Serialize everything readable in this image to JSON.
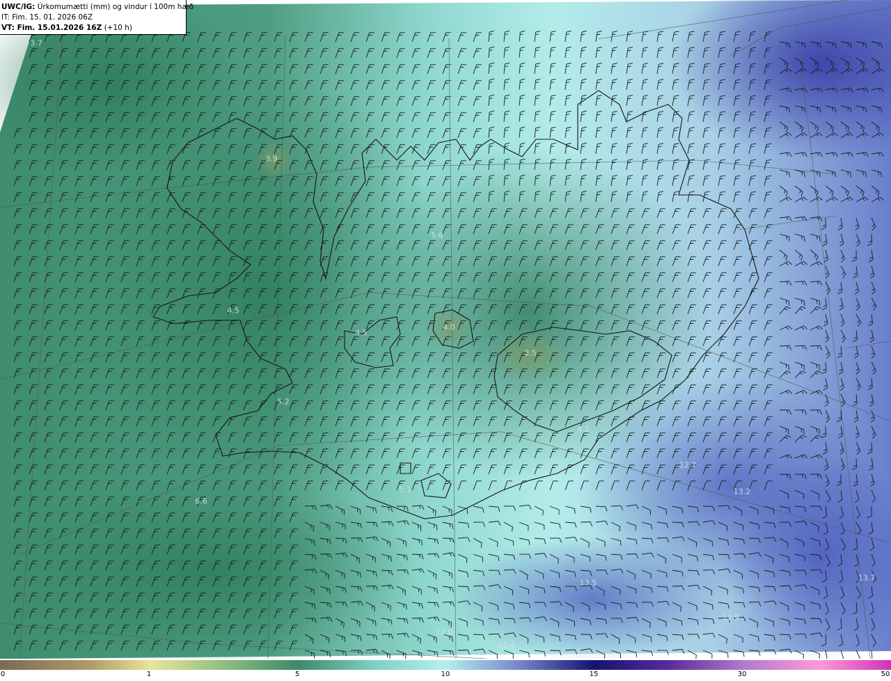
{
  "header": {
    "title_prefix": "UWC/IG:",
    "title_text": " Úrkomumætti (mm) og vindur í 100m hæð",
    "init_time": "IT: Fim. 15. 01. 2026 06Z",
    "valid_prefix": "VT: Fim. 15.01.2026 16Z",
    "valid_suffix": " (+10 h)"
  },
  "map": {
    "field_values": [
      {
        "text": "3.7"
      },
      {
        "text": "3.9"
      },
      {
        "text": "5.6"
      },
      {
        "text": "4.5"
      },
      {
        "text": "4.5"
      },
      {
        "text": "4.0"
      },
      {
        "text": "3.5"
      },
      {
        "text": "5.2"
      },
      {
        "text": "4.2"
      },
      {
        "text": "5.1"
      },
      {
        "text": "6.6"
      },
      {
        "text": "12.7"
      },
      {
        "text": "13.2"
      },
      {
        "text": "13.5"
      },
      {
        "text": "12.9"
      },
      {
        "text": "12.0"
      },
      {
        "text": "12.4"
      },
      {
        "text": "13.7"
      }
    ]
  },
  "colorbar": {
    "ticks": [
      "0",
      "1",
      "5",
      "10",
      "15",
      "30",
      "50"
    ],
    "colors": [
      "#7a6a55",
      "#c9b070",
      "#e8e59a",
      "#3d8a6a",
      "#a9eaea",
      "#3a3aa0",
      "#141470",
      "#8a3aa8",
      "#ff88dd",
      "#cc33bb"
    ]
  }
}
